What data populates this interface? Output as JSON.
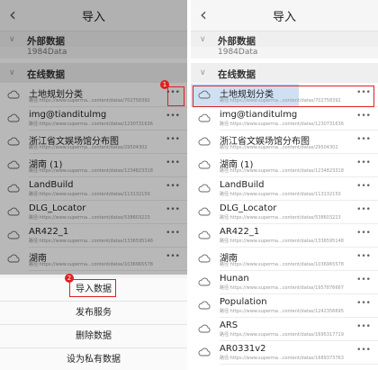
{
  "left": {
    "title": "导入",
    "back_icon": "chevron-left-icon",
    "external_header": "外部数据",
    "external_ghost": "1984Data",
    "online_header": "在线数据",
    "rows": [
      {
        "name": "土地规划分类",
        "path": "路径:https://www.superma...content/datas/702758392"
      },
      {
        "name": "img@tianditulmg",
        "path": "路径:https://www.superma...content/datas/1230731636"
      },
      {
        "name": "浙江省文娱场馆分布图",
        "path": "路径:https://www.superma...content/datas/29504302"
      },
      {
        "name": "湖南 (1)",
        "path": "路径:https://www.superma...content/datas/1234823318"
      },
      {
        "name": "LandBuild",
        "path": "路径:https://www.superma...content/datas/113132150"
      },
      {
        "name": "DLG_Locator",
        "path": "路径:https://www.superma...content/datas/538603223"
      },
      {
        "name": "AR422_1",
        "path": "路径:https://www.superma...content/datas/1336595148"
      },
      {
        "name": "湖南",
        "path": "路径:https://www.superma...content/datas/1036965578"
      }
    ],
    "sheet": [
      {
        "label": "导入数据"
      },
      {
        "label": "发布服务"
      },
      {
        "label": "删除数据"
      },
      {
        "label": "设为私有数据"
      }
    ],
    "badge_1": "1",
    "badge_2": "2"
  },
  "right": {
    "title": "导入",
    "back_icon": "chevron-left-icon",
    "external_header": "外部数据",
    "external_ghost": "1984Data",
    "online_header": "在线数据",
    "rows": [
      {
        "name": "土地规划分类",
        "path": "路径:https://www.superma...content/datas/702758392"
      },
      {
        "name": "img@tianditulmg",
        "path": "路径:https://www.superma...content/datas/1230731636"
      },
      {
        "name": "浙江省文娱场馆分布图",
        "path": "路径:https://www.superma...content/datas/29504302"
      },
      {
        "name": "湖南 (1)",
        "path": "路径:https://www.superma...content/datas/1234823318"
      },
      {
        "name": "LandBuild",
        "path": "路径:https://www.superma...content/datas/113132150"
      },
      {
        "name": "DLG_Locator",
        "path": "路径:https://www.superma...content/datas/538603223"
      },
      {
        "name": "AR422_1",
        "path": "路径:https://www.superma...content/datas/1336595148"
      },
      {
        "name": "湖南",
        "path": "路径:https://www.superma...content/datas/1036965578"
      },
      {
        "name": "Hunan",
        "path": "路径:https://www.superma...content/datas/1957876667"
      },
      {
        "name": "Population",
        "path": "路径:https://www.superma...content/datas/1242356695"
      },
      {
        "name": "ARS",
        "path": "路径:https://www.superma...content/datas/1695317719"
      },
      {
        "name": "AR0331v2",
        "path": "路径:https://www.superma...content/datas/1689373763"
      }
    ]
  },
  "more_icon": "more-dots-icon",
  "cloud_icon": "cloud-icon",
  "accent": "#e02020"
}
